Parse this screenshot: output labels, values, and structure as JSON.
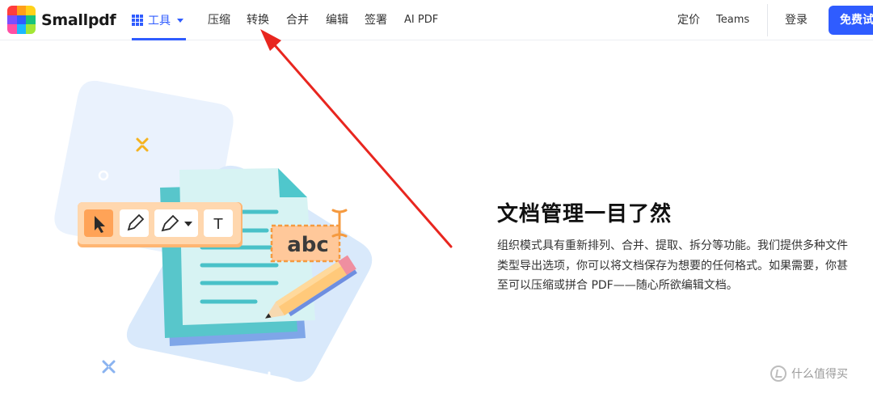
{
  "nav": {
    "logo_text": "Smallpdf",
    "tools_label": "工具",
    "links": [
      "压缩",
      "转换",
      "合并",
      "编辑",
      "签署",
      "AI PDF"
    ],
    "pricing": "定价",
    "teams": "Teams",
    "login": "登录",
    "cta": "免费试用"
  },
  "hero": {
    "title": "文档管理一目了然",
    "description": "组织模式具有重新排列、合并、提取、拆分等功能。我们提供多种文件类型导出选项，你可以将文档保存为想要的任何格式。如果需要，你甚至可以压缩或拼合 PDF——随心所欲编辑文档。"
  },
  "illustration": {
    "sample_text": "abc",
    "toolbar_text_tool": "T"
  },
  "watermark": {
    "text": "什么值得买"
  },
  "colors": {
    "brand_blue": "#2f5cff",
    "annotation_arrow": "#e8261f",
    "toolbar_orange": "#ffbf80",
    "document_teal": "#4fc7cc"
  },
  "icons": [
    "grid-icon",
    "caret-down-icon",
    "cursor-icon",
    "pencil-icon",
    "highlighter-icon",
    "text-cursor-icon",
    "sparkle-icon"
  ]
}
